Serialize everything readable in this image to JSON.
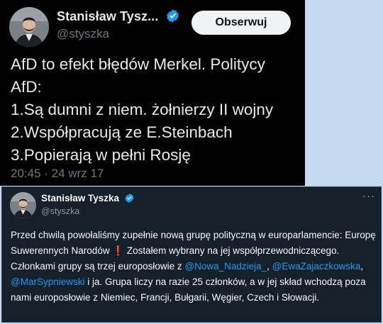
{
  "tweet_top": {
    "name": "Stanisław Tysz...",
    "handle": "@styszka",
    "follow_label": "Obserwuj",
    "lines": [
      "AfD to efekt błędów Merkel. Politycy",
      "AfD:",
      "1.Są dumni z niem. żołnierzy II wojny",
      "2.Współpracują ze E.Steinbach",
      "3.Popierają w pełni Rosję"
    ],
    "timestamp": "20:45 · 24 wrz 17"
  },
  "tweet_bottom": {
    "name": "Stanisław Tyszka",
    "handle": "@styszka",
    "more_icon": "···",
    "text_1": "Przed chwilą powołaliśmy zupełnie nową grupę polityczną w europarlamencie: Europę Suwerennych Narodów",
    "exclaim": "❗",
    "text_2": " Zostałem wybrany na jej współprzewodniczącego. Członkami grupy są trzej europosłowie z ",
    "mention_1": "@Nowa_Nadzieja_",
    "sep_1": ", ",
    "mention_2": "@EwaZajaczkowska",
    "sep_2": ", ",
    "mention_3": "@MarSypniewski",
    "text_3": " i ja. Grupa liczy na razie 25 członków, a w jej skład wchodzą poza nami europosłowie z Niemiec, Francji, Bułgarii, Węgier, Czech i Słowacji."
  },
  "colors": {
    "verified": "#1d9bf0",
    "mention": "#1d9bf0",
    "top_bg": "#000000",
    "bottom_bg": "#15202b",
    "page_bg": "#c3d9ee"
  }
}
